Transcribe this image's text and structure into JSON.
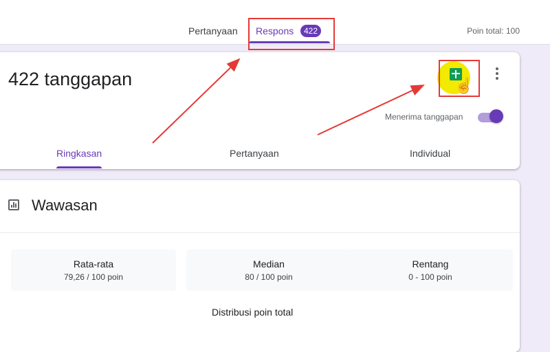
{
  "header": {
    "tabs": [
      {
        "label": "Pertanyaan"
      },
      {
        "label": "Respons",
        "badge": "422"
      }
    ],
    "points_total": "Poin total: 100"
  },
  "summary": {
    "response_count": "422 tanggapan",
    "accepting_label": "Menerima tanggapan",
    "accepting_on": true,
    "tabs": [
      {
        "label": "Ringkasan"
      },
      {
        "label": "Pertanyaan"
      },
      {
        "label": "Individual"
      }
    ]
  },
  "insights": {
    "title": "Wawasan",
    "stats": [
      {
        "label": "Rata-rata",
        "value": "79,26 / 100 poin"
      },
      {
        "label": "Median",
        "value": "80 / 100 poin"
      },
      {
        "label": "Rentang",
        "value": "0 - 100 poin"
      }
    ],
    "distribution_label": "Distribusi poin total"
  },
  "colors": {
    "accent": "#673ab7",
    "background": "#f0ebf8",
    "annotation": "#e53935",
    "sheets_green": "#0f9d58"
  },
  "icons": [
    "sheets-icon",
    "more-vert-icon",
    "insights-chart-icon",
    "hand-cursor-icon"
  ]
}
